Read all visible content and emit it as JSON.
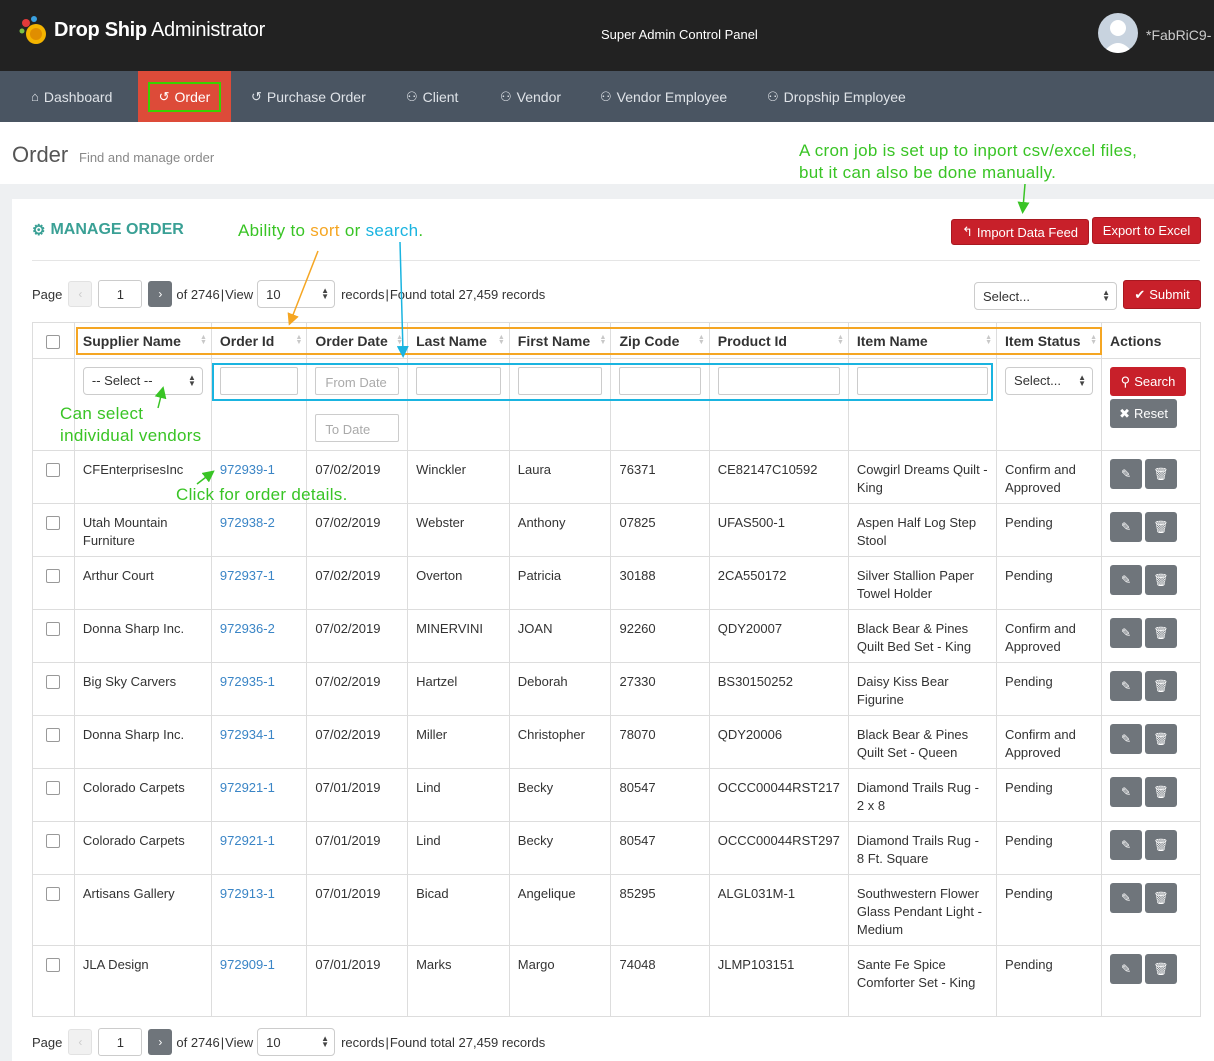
{
  "header": {
    "logo_brand": "Drop Ship",
    "logo_suffix": " Administrator",
    "panel_title": "Super Admin Control Panel",
    "username": "*FabRiC9-"
  },
  "nav": [
    {
      "label": "Dashboard",
      "icon": "home-icon"
    },
    {
      "label": "Order",
      "icon": "history-icon",
      "active": true
    },
    {
      "label": "Purchase Order",
      "icon": "history-icon"
    },
    {
      "label": "Client",
      "icon": "users-icon"
    },
    {
      "label": "Vendor",
      "icon": "users-icon"
    },
    {
      "label": "Vendor Employee",
      "icon": "users-icon"
    },
    {
      "label": "Dropship Employee",
      "icon": "users-icon"
    }
  ],
  "page": {
    "title": "Order",
    "subtitle": "Find and manage order"
  },
  "box": {
    "title": "MANAGE ORDER",
    "import_label": "Import Data Feed",
    "export_label": "Export to Excel",
    "bulk_select": "Select...",
    "submit_label": "Submit"
  },
  "pager": {
    "page_label": "Page",
    "page_value": "1",
    "of_text": "of 2746",
    "view_label": "View",
    "view_value": "10",
    "records_label": "records",
    "found_text": "Found total 27,459 records"
  },
  "columns": [
    "Supplier Name",
    "Order Id",
    "Order Date",
    "Last Name",
    "First Name",
    "Zip Code",
    "Product Id",
    "Item Name",
    "Item Status",
    "Actions"
  ],
  "filters": {
    "supplier_select": "-- Select --",
    "from_date": "From Date",
    "to_date": "To Date",
    "status_select": "Select...",
    "search_label": "Search",
    "reset_label": "Reset"
  },
  "rows": [
    {
      "supplier": "CFEnterprisesInc",
      "order_id": "972939-1",
      "date": "07/02/2019",
      "last": "Winckler",
      "first": "Laura",
      "zip": "76371",
      "product": "CE82147C10592",
      "item": "Cowgirl Dreams Quilt - King",
      "status": "Confirm and Approved"
    },
    {
      "supplier": "Utah Mountain Furniture",
      "order_id": "972938-2",
      "date": "07/02/2019",
      "last": "Webster",
      "first": "Anthony",
      "zip": "07825",
      "product": "UFAS500-1",
      "item": "Aspen Half Log Step Stool",
      "status": "Pending"
    },
    {
      "supplier": "Arthur Court",
      "order_id": "972937-1",
      "date": "07/02/2019",
      "last": "Overton",
      "first": "Patricia",
      "zip": "30188",
      "product": "2CA550172",
      "item": "Silver Stallion Paper Towel Holder",
      "status": "Pending"
    },
    {
      "supplier": "Donna Sharp Inc.",
      "order_id": "972936-2",
      "date": "07/02/2019",
      "last": "MINERVINI",
      "first": "JOAN",
      "zip": "92260",
      "product": "QDY20007",
      "item": "Black Bear & Pines Quilt Bed Set - King",
      "status": "Confirm and Approved"
    },
    {
      "supplier": "Big Sky Carvers",
      "order_id": "972935-1",
      "date": "07/02/2019",
      "last": "Hartzel",
      "first": "Deborah",
      "zip": "27330",
      "product": "BS30150252",
      "item": "Daisy Kiss Bear Figurine",
      "status": "Pending"
    },
    {
      "supplier": "Donna Sharp Inc.",
      "order_id": "972934-1",
      "date": "07/02/2019",
      "last": "Miller",
      "first": "Christopher",
      "zip": "78070",
      "product": "QDY20006",
      "item": "Black Bear & Pines Quilt Set - Queen",
      "status": "Confirm and Approved"
    },
    {
      "supplier": "Colorado Carpets",
      "order_id": "972921-1",
      "date": "07/01/2019",
      "last": "Lind",
      "first": "Becky",
      "zip": "80547",
      "product": "OCCC00044RST217",
      "item": "Diamond Trails Rug - 2 x 8",
      "status": "Pending"
    },
    {
      "supplier": "Colorado Carpets",
      "order_id": "972921-1",
      "date": "07/01/2019",
      "last": "Lind",
      "first": "Becky",
      "zip": "80547",
      "product": "OCCC00044RST297",
      "item": "Diamond Trails Rug - 8 Ft. Square",
      "status": "Pending"
    },
    {
      "supplier": "Artisans Gallery",
      "order_id": "972913-1",
      "date": "07/01/2019",
      "last": "Bicad",
      "first": "Angelique",
      "zip": "85295",
      "product": "ALGL031M-1",
      "item": "Southwestern Flower Glass Pendant Light - Medium",
      "status": "Pending"
    },
    {
      "supplier": "JLA Design",
      "order_id": "972909-1",
      "date": "07/01/2019",
      "last": "Marks",
      "first": "Margo",
      "zip": "74048",
      "product": "JLMP103151",
      "item": "Sante Fe Spice Comforter Set - King",
      "status": "Pending"
    }
  ],
  "annotations": {
    "cron_line1": "A cron job is set up to inport csv/excel files,",
    "cron_line2": "but it can also be done manually.",
    "sort_prefix": "Ability to ",
    "sort_word": "sort",
    "sort_or": " or ",
    "search_word": "search",
    "sort_suffix": ".",
    "vendors_line1": "Can select",
    "vendors_line2": "individual vendors",
    "details": "Click for order details."
  },
  "colors": {
    "accent_red": "#c8202a",
    "nav_active": "#dd4b39",
    "annotation_green": "#39c425",
    "annotation_orange": "#f5a623",
    "annotation_cyan": "#1ab4e0",
    "link_blue": "#3a85c6",
    "teal_title": "#3aa095"
  }
}
